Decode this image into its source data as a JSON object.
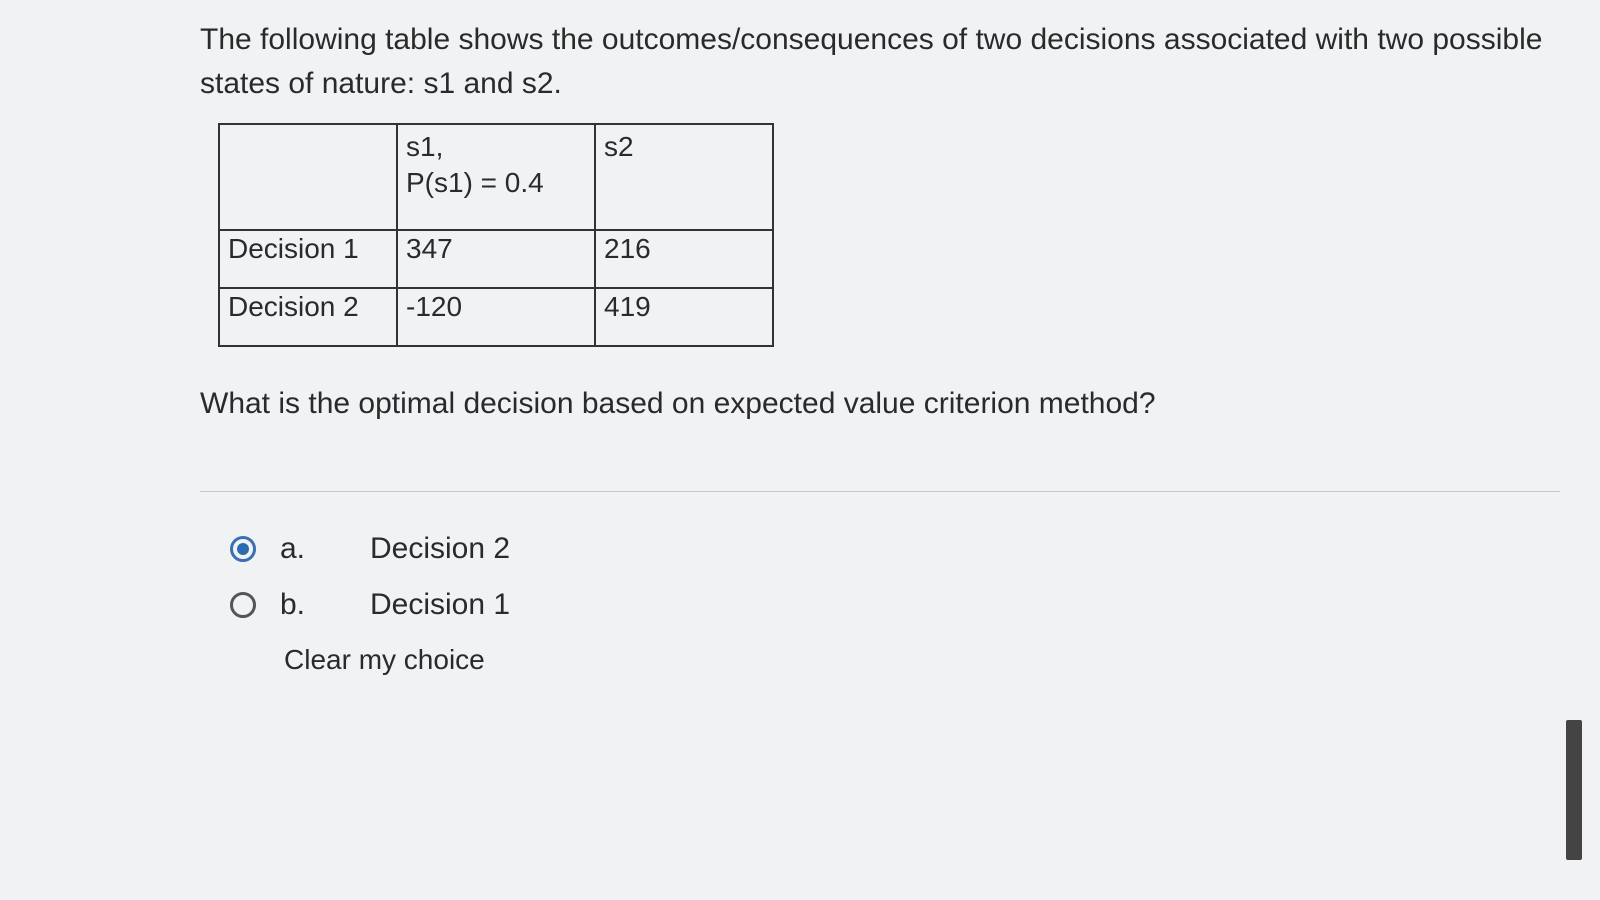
{
  "question": {
    "intro": "The following table shows the outcomes/consequences of two decisions associated with two possible states of nature: s1 and s2.",
    "prompt": "What is the optimal decision based on expected value criterion method?"
  },
  "table": {
    "header": {
      "blank": "",
      "s1_line1": "s1,",
      "s1_line2": "P(s1) = 0.4",
      "s2": "s2"
    },
    "rows": [
      {
        "label": "Decision 1",
        "s1": "347",
        "s2": "216"
      },
      {
        "label": "Decision 2",
        "s1": "-120",
        "s2": "419"
      }
    ]
  },
  "options": [
    {
      "letter": "a.",
      "text": "Decision 2",
      "selected": true
    },
    {
      "letter": "b.",
      "text": "Decision 1",
      "selected": false
    }
  ],
  "clear_label": "Clear my choice"
}
